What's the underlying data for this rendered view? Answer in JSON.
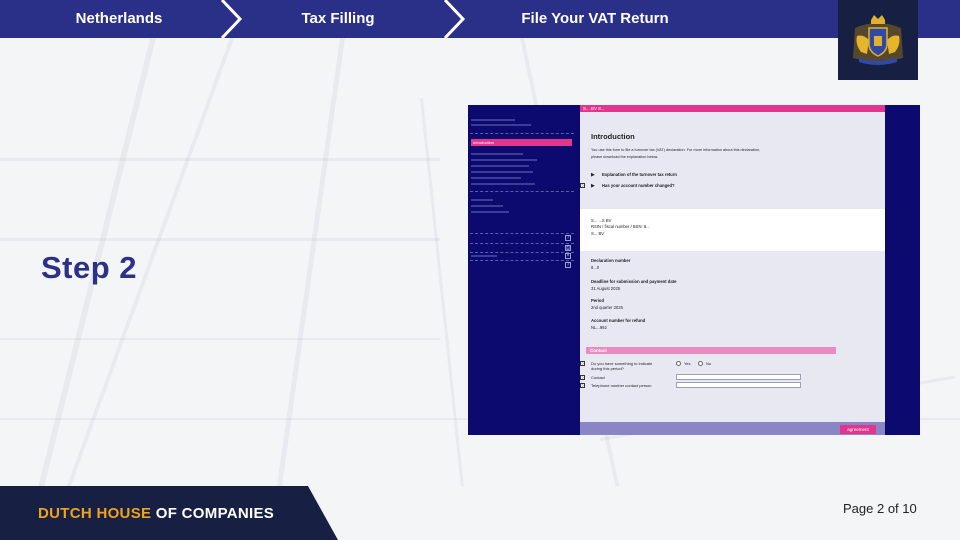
{
  "breadcrumb": {
    "items": [
      "Netherlands",
      "Tax Filling",
      "File Your VAT Return"
    ]
  },
  "logo": {
    "icon": "dutch-coat-of-arms-icon"
  },
  "step_label": "Step 2",
  "screenshot": {
    "company_line": "S... BV  8...",
    "nav_selected": "Introduction",
    "title": "Introduction",
    "intro_text_1": "You use this form to file a turnover tax (VAT) declaration. For more information about this declaration,",
    "intro_text_2": "please download the explanation below.",
    "link_1": "Explanation of the turnover tax return",
    "link_2": "Has your account number changed?",
    "company_name": "S... ...S BV",
    "rsin_line": "RSIN / fiscal number / BSN: 8...",
    "company_name_2": "S... BV",
    "declaration_label": "Declaration number",
    "declaration_value": "8...0",
    "deadline_label": "Deadline for submission and payment date",
    "deadline_value": "31 August 2025",
    "period_label": "Period",
    "period_value": "2nd quarter 2025",
    "refund_label": "Account number for refund",
    "refund_value": "NL...992",
    "contact_header": "Contact",
    "q_indicate": "Do you have something to indicate during this period?",
    "q_indicate_l1": "Do you have something to indicate",
    "q_indicate_l2": "during this period?",
    "radio_yes": "Yes",
    "radio_no": "No",
    "contact_label": "Contact",
    "phone_label": "Telephone number contact person",
    "agree_button": "agreement"
  },
  "footer": {
    "brand_orange": "DUTCH HOUSE",
    "brand_white": " OF COMPANIES",
    "page_info": "Page 2 of 10"
  },
  "colors": {
    "navy": "#2a2f88",
    "dark_navy": "#172042",
    "orange": "#f0a21b",
    "pink": "#e0368d"
  }
}
